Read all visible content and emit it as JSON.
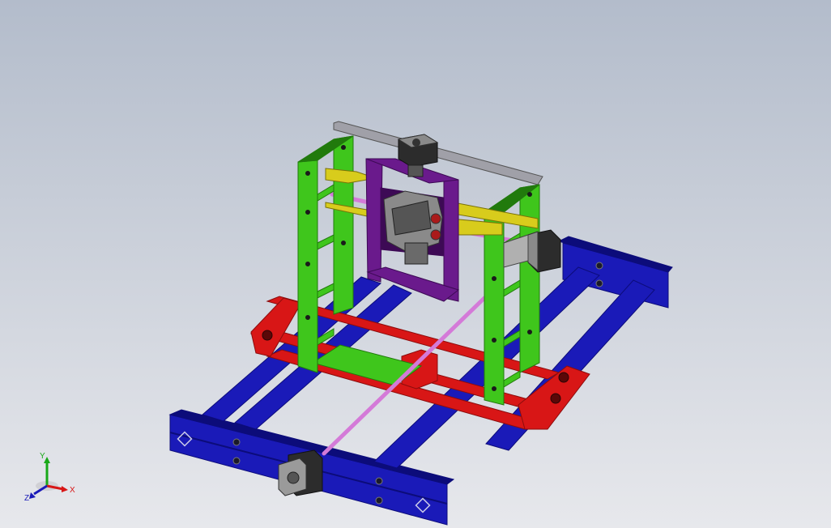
{
  "viewport": {
    "background_top": "#b3bccb",
    "background_bottom": "#e7e8ec"
  },
  "colors": {
    "base_frame_blue": "#1a1ab8",
    "base_frame_blue_dark": "#0c0c7a",
    "carriage_red": "#d81616",
    "carriage_red_dark": "#8c0c0c",
    "side_plate_green": "#3fc61c",
    "side_plate_green_dark": "#217a0c",
    "cross_bracket_yellow": "#d8cc1c",
    "z_carriage_purple": "#6a1a8c",
    "z_carriage_purple_dark": "#3d0a55",
    "guide_rod_pink": "#d47ad8",
    "top_rail_gray": "#a0a0a8",
    "stepper_motor_gray": "#3c3c3c",
    "spindle_gray": "#7a7a7a"
  },
  "triad": {
    "x_label": "X",
    "y_label": "Y",
    "z_label": "Z",
    "x_color": "#d81616",
    "y_color": "#18a818",
    "z_color": "#1a1ab8"
  }
}
